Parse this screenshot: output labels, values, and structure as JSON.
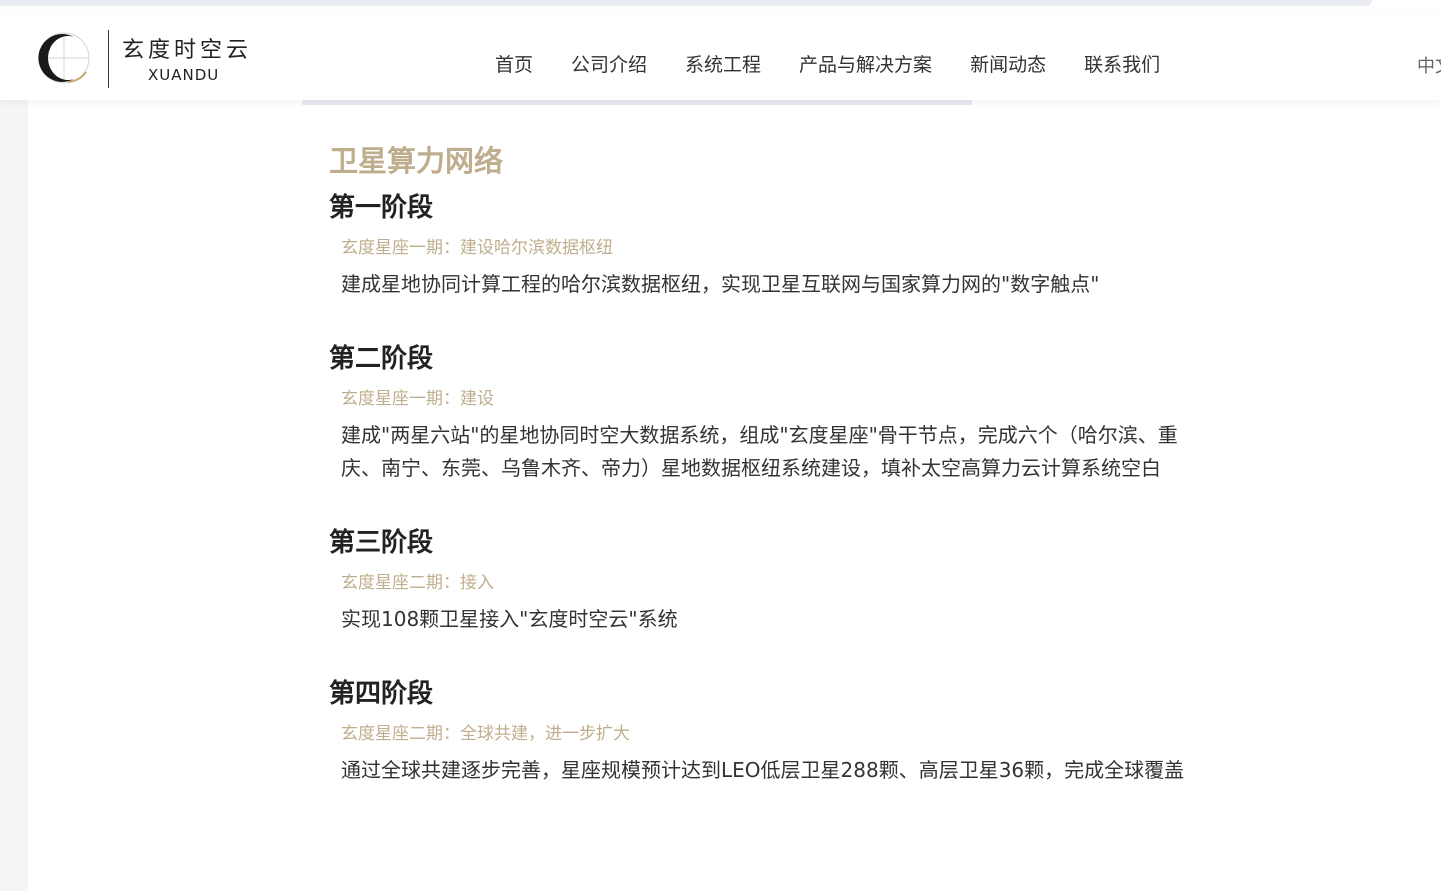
{
  "brand": {
    "name_cn": "玄度时空云",
    "name_en": "XUANDU"
  },
  "nav": {
    "items": [
      {
        "label": "首页"
      },
      {
        "label": "公司介绍"
      },
      {
        "label": "系统工程"
      },
      {
        "label": "产品与解决方案"
      },
      {
        "label": "新闻动态"
      },
      {
        "label": "联系我们"
      }
    ],
    "language": "中文"
  },
  "main": {
    "section_title": "卫星算力网络",
    "phases": [
      {
        "title": "第一阶段",
        "subtitle": "玄度星座一期：建设哈尔滨数据枢纽",
        "description": "建成星地协同计算工程的哈尔滨数据枢纽，实现卫星互联网与国家算力网的\"数字触点\""
      },
      {
        "title": "第二阶段",
        "subtitle": "玄度星座一期：建设",
        "description": "建成\"两星六站\"的星地协同时空大数据系统，组成\"玄度星座\"骨干节点，完成六个（哈尔滨、重庆、南宁、东莞、乌鲁木齐、帝力）星地数据枢纽系统建设，填补太空高算力云计算系统空白"
      },
      {
        "title": "第三阶段",
        "subtitle": "玄度星座二期：接入",
        "description": "实现108颗卫星接入\"玄度时空云\"系统"
      },
      {
        "title": "第四阶段",
        "subtitle": "玄度星座二期：全球共建，进一步扩大",
        "description": "通过全球共建逐步完善，星座规模预计达到LEO低层卫星288颗、高层卫星36颗，完成全球覆盖"
      }
    ]
  },
  "colors": {
    "accent_gold": "#bfae8d",
    "text_dark": "#222222",
    "text_body": "#333333"
  }
}
